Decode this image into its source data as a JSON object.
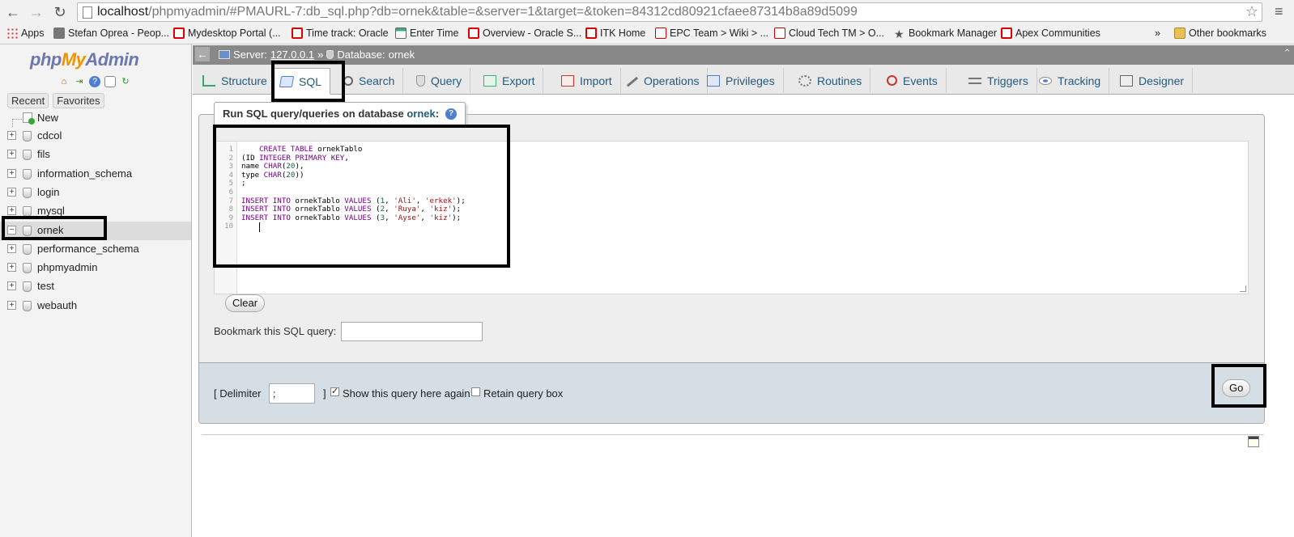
{
  "browser": {
    "url_host": "localhost",
    "url_path": "/phpmyadmin/#PMAURL-7:db_sql.php?db=ornek&table=&server=1&target=&token=84312cd80921cfaee87314b8a89d5099",
    "bookmarks": [
      {
        "label": "Apps",
        "icon": "apps-icon"
      },
      {
        "label": "Stefan Oprea - Peop...",
        "icon": "user-icon"
      },
      {
        "label": "Mydesktop Portal (...",
        "icon": "oracle-icon"
      },
      {
        "label": "Time track: Oracle",
        "icon": "oracle-icon"
      },
      {
        "label": "Enter Time",
        "icon": "calendar-icon"
      },
      {
        "label": "Overview - Oracle S...",
        "icon": "oracle-icon"
      },
      {
        "label": "ITK Home",
        "icon": "oracle-icon"
      },
      {
        "label": "EPC Team > Wiki > ...",
        "icon": "wiki-icon"
      },
      {
        "label": "Cloud Tech TM > O...",
        "icon": "wiki-icon"
      },
      {
        "label": "Bookmark Manager",
        "icon": "star-icon"
      },
      {
        "label": "Apex Communities",
        "icon": "oracle-icon"
      }
    ],
    "overflow_label": "»",
    "other_bookmarks": "Other bookmarks"
  },
  "sidebar": {
    "logo_php": "php",
    "logo_my": "My",
    "logo_admin": "Admin",
    "tabs": [
      "Recent",
      "Favorites"
    ],
    "new_label": "New",
    "databases": [
      {
        "name": "cdcol",
        "expander": "+"
      },
      {
        "name": "fils",
        "expander": "+"
      },
      {
        "name": "information_schema",
        "expander": "+"
      },
      {
        "name": "login",
        "expander": "+"
      },
      {
        "name": "mysql",
        "expander": "+"
      },
      {
        "name": "ornek",
        "expander": "−",
        "selected": true
      },
      {
        "name": "performance_schema",
        "expander": "+"
      },
      {
        "name": "phpmyadmin",
        "expander": "+"
      },
      {
        "name": "test",
        "expander": "+"
      },
      {
        "name": "webauth",
        "expander": "+"
      }
    ]
  },
  "breadcrumb": {
    "server_label": "Server:",
    "server_value": "127.0.0.1",
    "separator": "»",
    "database_label": "Database:",
    "database_value": "ornek"
  },
  "tabs": [
    {
      "label": "Structure",
      "icon": "structure-icon"
    },
    {
      "label": "SQL",
      "icon": "sql-icon",
      "active": true
    },
    {
      "label": "Search",
      "icon": "search-icon"
    },
    {
      "label": "Query",
      "icon": "query-icon"
    },
    {
      "label": "Export",
      "icon": "export-icon"
    },
    {
      "label": "Import",
      "icon": "import-icon"
    },
    {
      "label": "Operations",
      "icon": "operations-icon"
    },
    {
      "label": "Privileges",
      "icon": "privileges-icon"
    },
    {
      "label": "Routines",
      "icon": "routines-icon"
    },
    {
      "label": "Events",
      "icon": "events-icon"
    },
    {
      "label": "Triggers",
      "icon": "triggers-icon"
    },
    {
      "label": "Tracking",
      "icon": "tracking-icon"
    },
    {
      "label": "Designer",
      "icon": "designer-icon"
    }
  ],
  "sql_panel": {
    "legend_prefix": "Run SQL query/queries on database",
    "legend_db": "ornek",
    "legend_suffix": ":",
    "line_numbers": [
      "1",
      "2",
      "3",
      "4",
      "5",
      "6",
      "7",
      "8",
      "9",
      "10"
    ],
    "code_lines": [
      "    CREATE TABLE ornekTablo",
      "(ID INTEGER PRIMARY KEY,",
      "name CHAR(20),",
      "type CHAR(20))",
      ";",
      "",
      "INSERT INTO ornekTablo VALUES (1, 'Ali', 'erkek');",
      "INSERT INTO ornekTablo VALUES (2, 'Ruya', 'kiz');",
      "INSERT INTO ornekTablo VALUES (3, 'Ayse', 'kiz');",
      ""
    ],
    "clear_label": "Clear",
    "bookmark_label": "Bookmark this SQL query:",
    "bookmark_value": "",
    "delimiter_open": "[ Delimiter",
    "delimiter_value": ";",
    "delimiter_close": "]",
    "show_query_label": "Show this query here again",
    "show_query_checked": true,
    "retain_label": "Retain query box",
    "retain_checked": false,
    "go_label": "Go"
  }
}
